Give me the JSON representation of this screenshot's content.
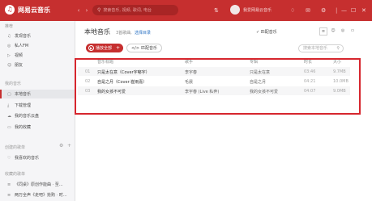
{
  "app": {
    "logo": "网易云音乐",
    "logo_glyph": "♫",
    "accent": "#c62f2f"
  },
  "topbar": {
    "back": "‹",
    "forward": "›",
    "search_placeholder": "搜索音乐, 视频, 歌词, 电台",
    "username": "我爱网易云音乐",
    "icons": [
      "sync-icon",
      "skin-icon",
      "mail-icon",
      "settings-icon"
    ]
  },
  "sidebar": {
    "recommend_title": "推荐",
    "recommend": [
      "发现音乐",
      "私人FM",
      "视频",
      "朋友"
    ],
    "mymusic_title": "我的音乐",
    "mymusic": [
      "本地音乐",
      "下载管理",
      "我的音乐云盘",
      "我的收藏"
    ],
    "created_title": "创建的歌单",
    "created": [
      "我喜欢的音乐"
    ],
    "collected_title": "收藏的歌单",
    "collected": [
      "《同桌》原创作能曲 · 至...",
      "两万全声《走吧》抢购 · 时..."
    ]
  },
  "main": {
    "title": "本地音乐",
    "count": "3首歌曲,",
    "select_dir": "选择目录",
    "match": "匹配音乐",
    "play_all": "播放全部",
    "import": "匹配音乐",
    "search_placeholder": "搜索本地音乐",
    "headers": [
      "音乐标题",
      "歌手",
      "专辑",
      "时长",
      "大小"
    ],
    "rows": [
      {
        "no": "01",
        "title": "只是太在意（Cover宇嘟宇）",
        "artist": "李宇春",
        "album": "只是太在意",
        "time": "03:46",
        "size": "9.7MB"
      },
      {
        "no": "02",
        "title": "自是之月（Cover:崔雨嘉）",
        "artist": "毛晨",
        "album": "自是之月",
        "time": "04:21",
        "size": "10.0MB"
      },
      {
        "no": "03",
        "title": "我的女孩不可爱",
        "artist": "李宇春 (Live 私奔)",
        "album": "我的女孩不可爱",
        "time": "04:07",
        "size": "9.0MB"
      }
    ]
  }
}
